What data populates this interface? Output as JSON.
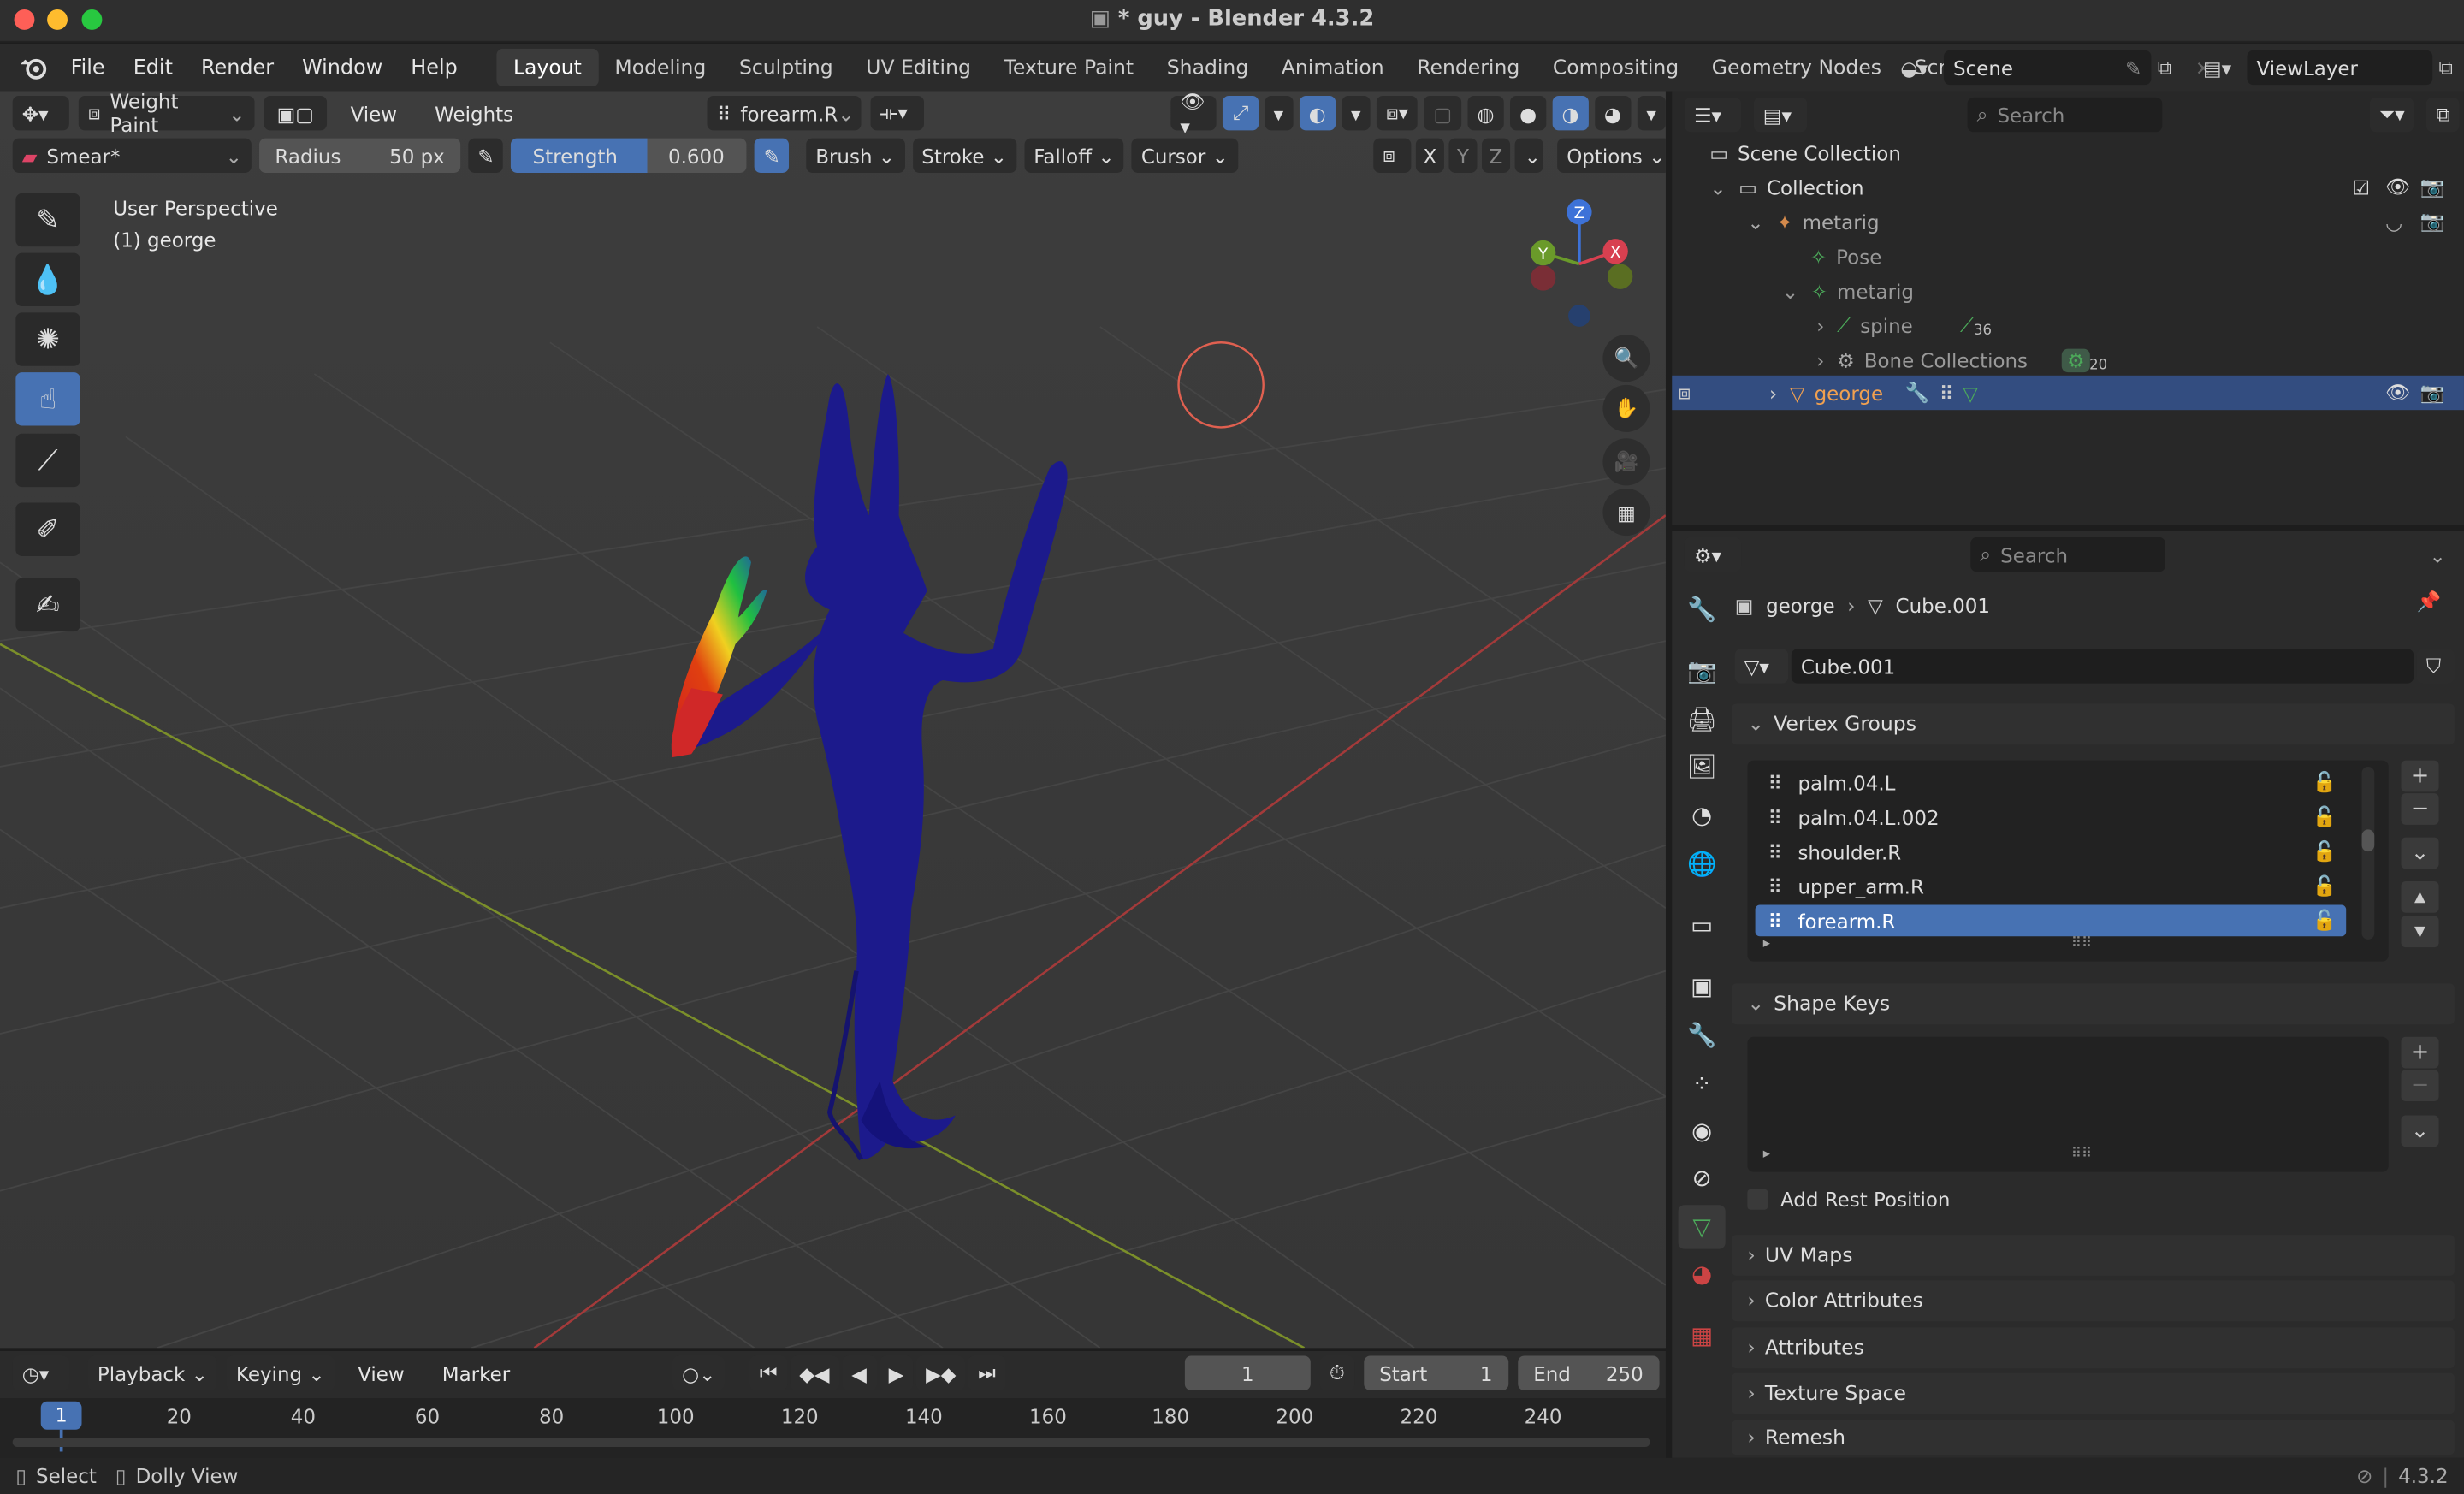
{
  "window": {
    "title": "* guy - Blender 4.3.2"
  },
  "menus": [
    "File",
    "Edit",
    "Render",
    "Window",
    "Help"
  ],
  "workspaces": [
    "Layout",
    "Modeling",
    "Sculpting",
    "UV Editing",
    "Texture Paint",
    "Shading",
    "Animation",
    "Rendering",
    "Compositing",
    "Geometry Nodes",
    "Scripting"
  ],
  "scene": {
    "name": "Scene",
    "view_layer": "ViewLayer"
  },
  "viewport_header": {
    "mode": "Weight Paint",
    "view": "View",
    "weights": "Weights",
    "active_group": "forearm.R",
    "brush": "Smear*",
    "radius_label": "Radius",
    "radius_value": "50 px",
    "strength_label": "Strength",
    "strength_value": "0.600",
    "menus": [
      "Brush",
      "Stroke",
      "Falloff",
      "Cursor"
    ],
    "axes": [
      "X",
      "Y",
      "Z"
    ],
    "options": "Options"
  },
  "viewport": {
    "perspective": "User Perspective",
    "object": "(1) george",
    "gizmo": {
      "z": "Z",
      "y": "Y",
      "x": "X"
    }
  },
  "outliner": {
    "search_placeholder": "Search",
    "rows": [
      {
        "label": "Scene Collection"
      },
      {
        "label": "Collection"
      },
      {
        "label": "metarig"
      },
      {
        "label": "Pose"
      },
      {
        "label": "metarig"
      },
      {
        "label": "spine",
        "badge": "36"
      },
      {
        "label": "Bone Collections",
        "badge": "20"
      },
      {
        "label": "george"
      }
    ]
  },
  "properties": {
    "search_placeholder": "Search",
    "breadcrumb_object": "george",
    "breadcrumb_data": "Cube.001",
    "mesh_name": "Cube.001",
    "vertex_groups_title": "Vertex Groups",
    "vertex_groups": [
      "palm.04.L",
      "palm.04.L.002",
      "shoulder.R",
      "upper_arm.R",
      "forearm.R"
    ],
    "shape_keys_title": "Shape Keys",
    "add_rest_position": "Add Rest Position",
    "panels": [
      "UV Maps",
      "Color Attributes",
      "Attributes",
      "Texture Space",
      "Remesh"
    ]
  },
  "timeline": {
    "menus": [
      "Playback",
      "Keying",
      "View",
      "Marker"
    ],
    "current_frame": "1",
    "start_label": "Start",
    "start_value": "1",
    "end_label": "End",
    "end_value": "250",
    "ticks": [
      "1",
      "20",
      "40",
      "60",
      "80",
      "100",
      "120",
      "140",
      "160",
      "180",
      "200",
      "220",
      "240"
    ]
  },
  "statusbar": {
    "select": "Select",
    "dolly": "Dolly View",
    "version": "4.3.2"
  },
  "colors": {
    "accent": "#4772b3",
    "selected_row": "#334d80",
    "active_object": "#f0a050"
  }
}
